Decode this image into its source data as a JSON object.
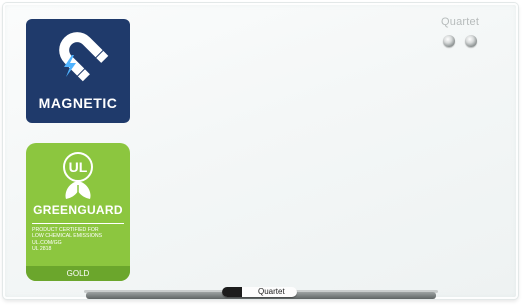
{
  "board": {
    "brand": "Quartet"
  },
  "magnetic_badge": {
    "label": "MAGNETIC",
    "icon": "magnet-icon",
    "color": "#1f3a6b"
  },
  "greenguard_badge": {
    "logo_text": "UL",
    "title": "GREENGUARD",
    "lines": [
      "PRODUCT CERTIFIED FOR",
      "LOW CHEMICAL EMISSIONS",
      "UL.COM/GG",
      "UL 2818"
    ],
    "level": "GOLD",
    "color": "#8cc63f"
  },
  "marker": {
    "brand": "Quartet"
  }
}
